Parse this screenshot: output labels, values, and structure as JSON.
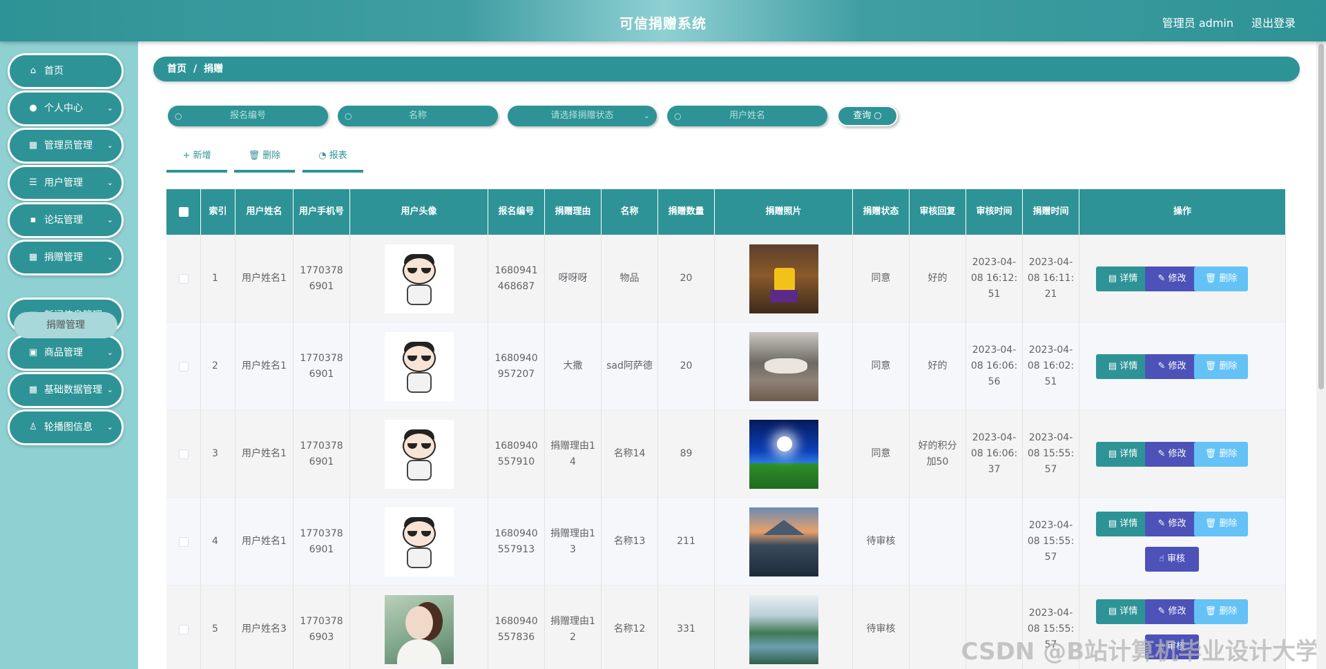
{
  "header": {
    "title": "可信捐赠系统",
    "user": "管理员 admin",
    "logout": "退出登录"
  },
  "sidebar": {
    "items": [
      {
        "label": "首页",
        "icon": "home-icon",
        "glyph": "⌂",
        "arrow": ""
      },
      {
        "label": "个人中心",
        "icon": "user-icon",
        "glyph": "●",
        "arrow": "⌄"
      },
      {
        "label": "管理员管理",
        "icon": "grid-icon",
        "glyph": "▦",
        "arrow": "⌄"
      },
      {
        "label": "用户管理",
        "icon": "list-icon",
        "glyph": "☰",
        "arrow": "⌄"
      },
      {
        "label": "论坛管理",
        "icon": "chat-icon",
        "glyph": "▪",
        "arrow": "⌄"
      },
      {
        "label": "捐赠管理",
        "icon": "grid-icon",
        "glyph": "▦",
        "arrow": "⌄"
      },
      {
        "label": "新闻信息管理",
        "icon": "grid-icon",
        "glyph": "▦",
        "arrow": "⌄"
      },
      {
        "label": "商品管理",
        "icon": "clipboard-icon",
        "glyph": "▣",
        "arrow": "⌄"
      },
      {
        "label": "基础数据管理",
        "icon": "grid-icon",
        "glyph": "▦",
        "arrow": "⌄"
      },
      {
        "label": "轮播图信息",
        "icon": "person-icon",
        "glyph": "♙",
        "arrow": "⌄"
      }
    ],
    "sub_item": "捐赠管理"
  },
  "breadcrumb": {
    "home": "首页",
    "sep": "/",
    "current": "捐赠"
  },
  "search": {
    "fields": [
      {
        "placeholder": "报名编号"
      },
      {
        "placeholder": "名称"
      },
      {
        "placeholder": "请选择捐赠状态"
      },
      {
        "placeholder": "用户姓名"
      }
    ],
    "query_label": "查询"
  },
  "actions": {
    "add": "+ 新增",
    "delete": "🗑 删除",
    "report": "◔ 报表"
  },
  "table": {
    "headers": [
      "",
      "索引",
      "用户姓名",
      "用户手机号",
      "用户头像",
      "报名编号",
      "捐赠理由",
      "名称",
      "捐赠数量",
      "捐赠照片",
      "捐赠状态",
      "审核回复",
      "审核时间",
      "捐赠时间",
      "操作"
    ],
    "rows": [
      {
        "index": "1",
        "name": "用户姓名1",
        "phone": "17703786901",
        "code": "1680941468687",
        "reason": "呀呀呀",
        "title": "物品",
        "amount": "20",
        "status": "同意",
        "reply": "好的",
        "audit_time": "2023-04-08 16:12:51",
        "donate_time": "2023-04-08 16:11:21"
      },
      {
        "index": "2",
        "name": "用户姓名1",
        "phone": "17703786901",
        "code": "1680940957207",
        "reason": "大撒",
        "title": "sad阿萨德",
        "amount": "20",
        "status": "同意",
        "reply": "好的",
        "audit_time": "2023-04-08 16:06:56",
        "donate_time": "2023-04-08 16:02:51"
      },
      {
        "index": "3",
        "name": "用户姓名1",
        "phone": "17703786901",
        "code": "1680940557910",
        "reason": "捐赠理由14",
        "title": "名称14",
        "amount": "89",
        "status": "同意",
        "reply": "好的积分加50",
        "audit_time": "2023-04-08 16:06:37",
        "donate_time": "2023-04-08 15:55:57"
      },
      {
        "index": "4",
        "name": "用户姓名1",
        "phone": "17703786901",
        "code": "1680940557913",
        "reason": "捐赠理由13",
        "title": "名称13",
        "amount": "211",
        "status": "待审核",
        "reply": "",
        "audit_time": "",
        "donate_time": "2023-04-08 15:55:57"
      },
      {
        "index": "5",
        "name": "用户姓名3",
        "phone": "17703786903",
        "code": "1680940557836",
        "reason": "捐赠理由12",
        "title": "名称12",
        "amount": "331",
        "status": "待审核",
        "reply": "",
        "audit_time": "",
        "donate_time": "2023-04-08 15:55:57"
      }
    ],
    "ops": {
      "detail": "详情",
      "edit": "修改",
      "delete": "删除",
      "audit": "审核"
    }
  },
  "watermark": "CSDN @B站计算机毕业设计大学"
}
